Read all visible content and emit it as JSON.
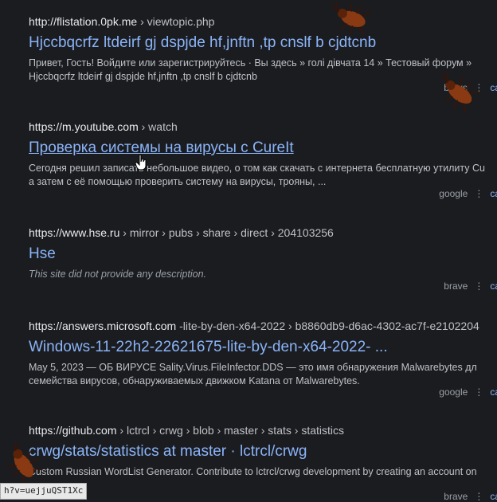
{
  "results": [
    {
      "url_host": "http://flistation.0pk.me",
      "url_path": "› viewtopic.php",
      "title": "Hjccbqcrfz ltdeirf gj dspjde hf,jnftn ,tp cnslf b cjdtcnb",
      "snippet_lines": [
        "Привет, Гость! Войдите или зарегистрируйтесь · Вы здесь » голі дівчата 14 » Тестовый форум »",
        "Hjccbqcrfz ltdeirf gj dspjde hf,jnftn ,tp cnslf b cjdtcnb"
      ],
      "source": "brave",
      "cached_label": "ca"
    },
    {
      "url_host": "https://m.youtube.com",
      "url_path": "› watch",
      "title": "Проверка системы на вирусы с CureIt",
      "snippet_lines": [
        "Сегодня решил записать небольшое видео, о том как скачать с интернета бесплатную утилиту Cu",
        "а затем с её помощью проверить систему на вирусы, трояны, ..."
      ],
      "source": "google",
      "cached_label": "ca"
    },
    {
      "url_host": "https://www.hse.ru",
      "url_path": "› mirror › pubs › share › direct › 204103256",
      "title": "Hse",
      "snippet_lines": [
        "This site did not provide any description."
      ],
      "source": "brave",
      "cached_label": "ca"
    },
    {
      "url_host": "https://answers.microsoft.com",
      "url_path": "-lite-by-den-x64-2022 › b8860db9-d6ac-4302-ac7f-e2102204",
      "title": "Windows-11-22h2-22621675-lite-by-den-x64-2022- ...",
      "snippet_lines": [
        "May 5, 2023 — ОБ ВИРУСЕ Sality.Virus.FileInfector.DDS — это имя обнаружения Malwarebytes дл",
        "семейства вирусов, обнаруживаемых движком Katana от Malwarebytes."
      ],
      "source": "google",
      "cached_label": "ca"
    },
    {
      "url_host": "https://github.com",
      "url_path": "› lctrcl › crwg › blob › master › stats › statistics",
      "title": "crwg/stats/statistics at master · lctrcl/crwg",
      "snippet_lines": [
        "Custom Russian WordList Generator. Contribute to lctrcl/crwg development by creating an account on"
      ],
      "source": "brave",
      "cached_label": "ca"
    }
  ],
  "status_bar": "h?v=uejjuQST1Xc"
}
